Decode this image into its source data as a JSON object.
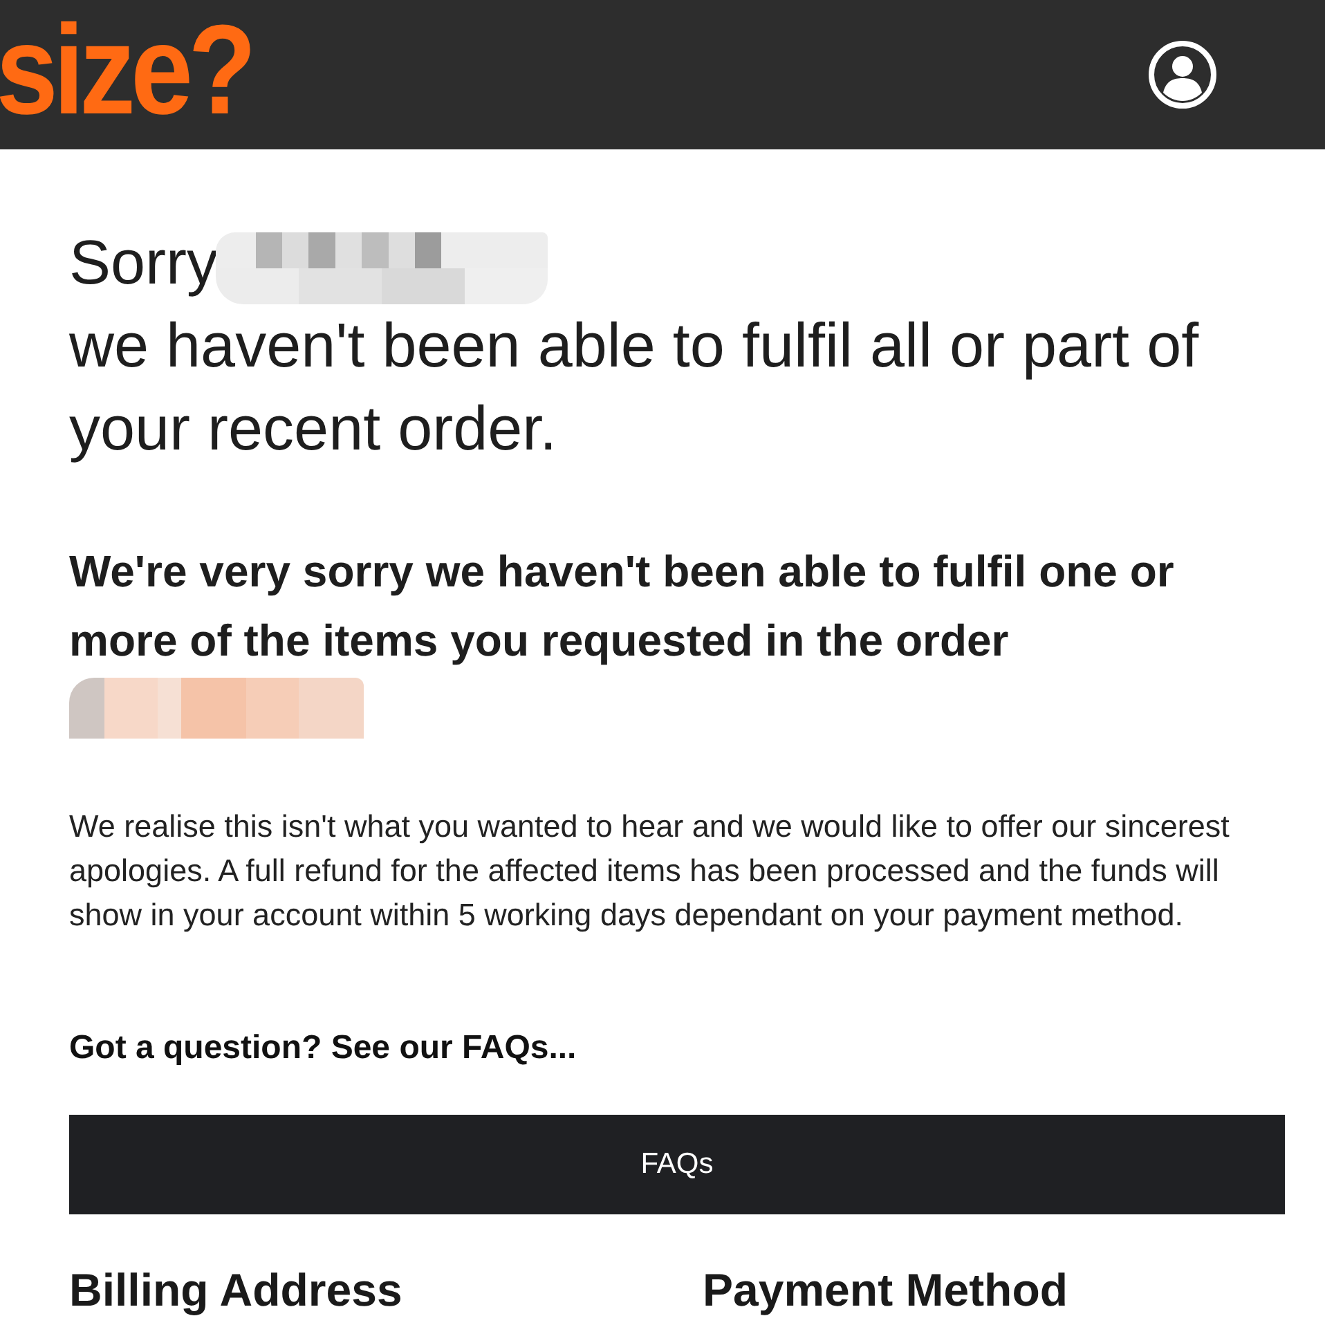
{
  "header": {
    "logo": "size?"
  },
  "title": {
    "greeting": "Sorry",
    "message": "we haven't been able to fulfil all or part of your recent order."
  },
  "subtitle": "We're very sorry we haven't been able to fulfil one or more of the items you requested in the order",
  "body": "We realise this isn't what you wanted to hear and we would like to offer our sincerest apologies. A full refund for the affected items has been processed and the funds will show in your account within 5 working days dependant on your payment method.",
  "faq": {
    "prompt": "Got a question? See our FAQs...",
    "button": "FAQs"
  },
  "sections": [
    {
      "heading": "Billing Address"
    },
    {
      "heading": "Payment Method"
    }
  ]
}
